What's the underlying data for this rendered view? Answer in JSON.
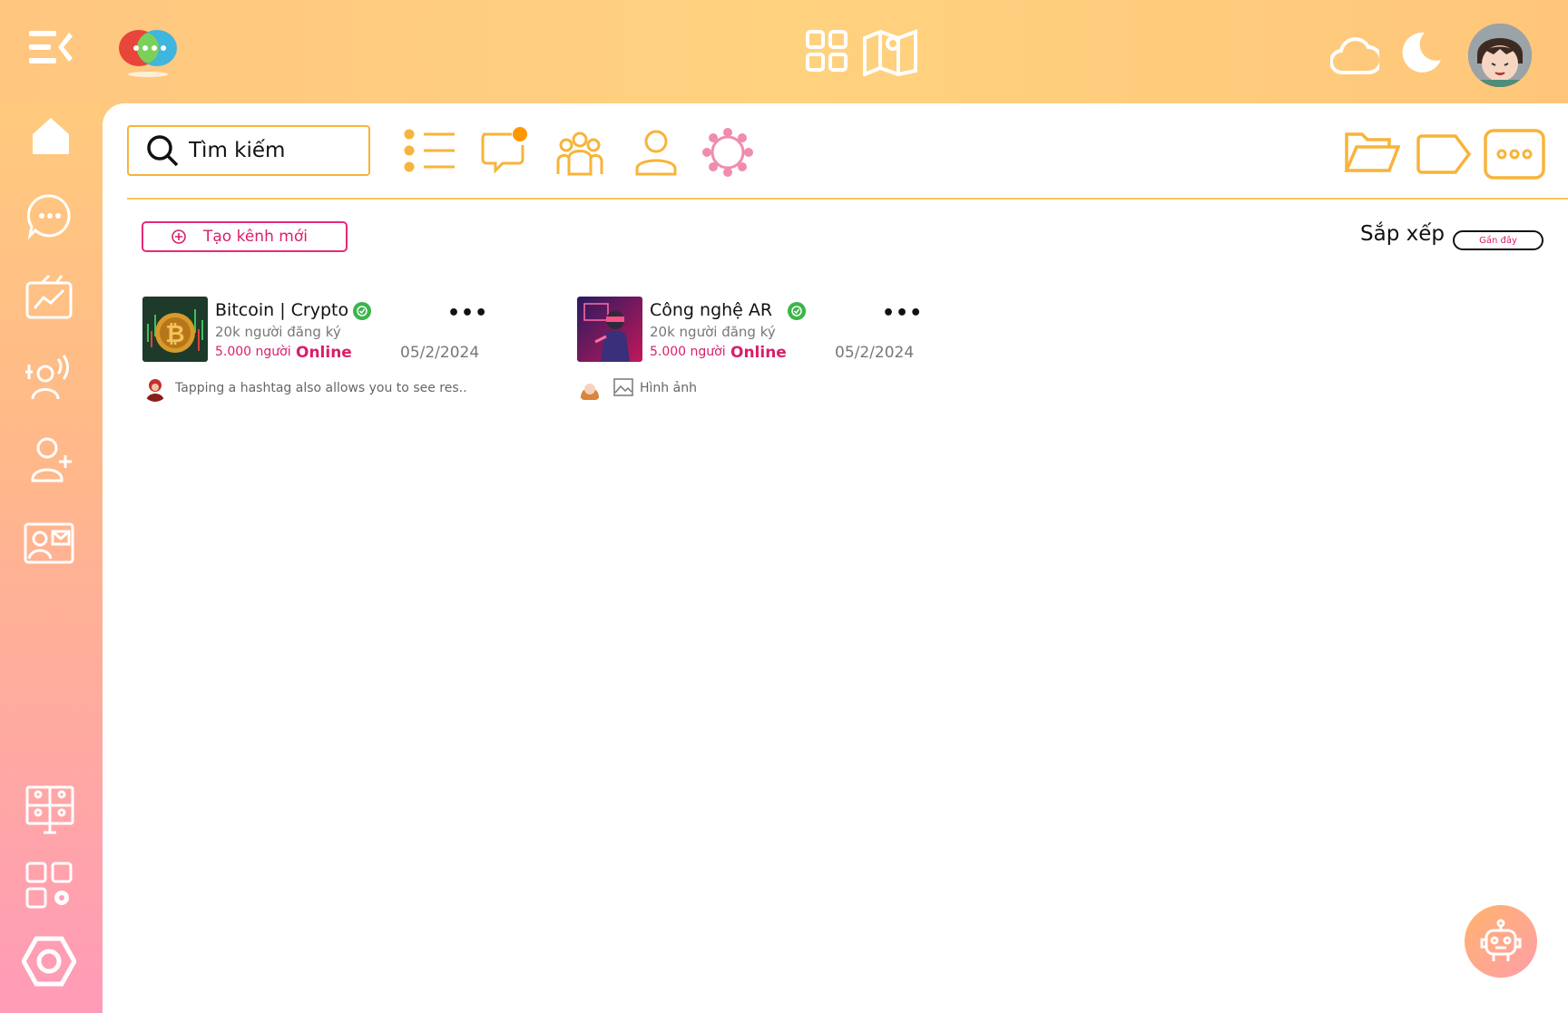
{
  "search": {
    "placeholder": "Tìm kiếm"
  },
  "main": {
    "create_button_label": "Tạo kênh mới",
    "sort_label": "Sắp xếp",
    "sort_value": "Gần đây"
  },
  "channels": [
    {
      "name": "Bitcoin | Crypto",
      "subscribers": "20k người đăng ký",
      "online_count": "5.000 người",
      "online_label": "Online",
      "date": "05/2/2024",
      "more": "•••",
      "last_message": "Tapping a hashtag also allows you to see res.."
    },
    {
      "name": "Công nghệ AR",
      "subscribers": "20k người đăng ký",
      "online_count": "5.000 người",
      "online_label": "Online",
      "date": "05/2/2024",
      "more": "•••",
      "last_message": "Hình ảnh"
    }
  ],
  "colors": {
    "accent_orange": "#f7b43a",
    "accent_pink": "#d81f6b",
    "verified_green": "#3bb54a"
  },
  "icons": {
    "sidebar": [
      "collapse-menu-icon",
      "home-icon",
      "chat-icon",
      "live-tv-icon",
      "voice-user-icon",
      "add-user-icon",
      "contact-card-icon",
      "video-conference-icon",
      "apps-settings-icon",
      "hexagon-icon"
    ],
    "topbar": [
      "app-logo-icon",
      "grid-icon",
      "map-icon",
      "cloud-icon",
      "moon-icon",
      "user-avatar"
    ],
    "toolbar": [
      "search-icon",
      "list-icon",
      "notification-chat-icon",
      "group-icon",
      "user-icon",
      "network-icon",
      "folder-icon",
      "tag-icon",
      "more-icon"
    ]
  }
}
